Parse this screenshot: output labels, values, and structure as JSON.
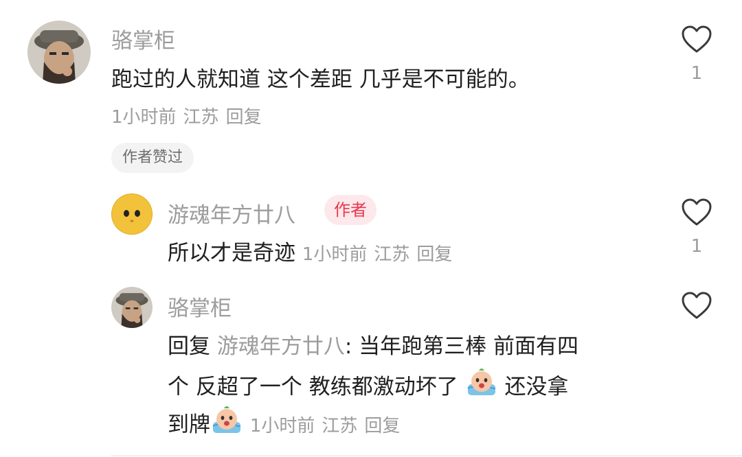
{
  "comments": [
    {
      "user": "骆掌柜",
      "text": "跑过的人就知道 这个差距 几乎是不可能的。",
      "time": "1小时前",
      "location": "江苏",
      "reply_label": "回复",
      "likes": "1",
      "liked_badge": "作者赞过"
    }
  ],
  "replies": [
    {
      "user": "游魂年方廿八",
      "author_tag": "作者",
      "text": "所以才是奇迹",
      "time": "1小时前",
      "location": "江苏",
      "reply_label": "回复",
      "likes": "1"
    },
    {
      "user": "骆掌柜",
      "reply_prefix": "回复",
      "reply_to": "游魂年方廿八",
      "colon": ":",
      "line1": "当年跑第三棒  前面有四",
      "line2": "个   反超了一个 教练都激动坏了",
      "line3_after_emoji": " 还没拿",
      "line4": "到牌",
      "emoji_name": "crying-emoji",
      "time": "1小时前",
      "location": "江苏",
      "reply_label": "回复",
      "likes": ""
    }
  ],
  "colors": {
    "muted": "#9c9c9c",
    "text": "#1f1f1f",
    "author_tag_bg": "#fde8ec",
    "author_tag_fg": "#e8384f",
    "badge_bg": "#f3f3f3"
  },
  "icons": [
    "heart-outline-icon",
    "crying-emoji"
  ]
}
